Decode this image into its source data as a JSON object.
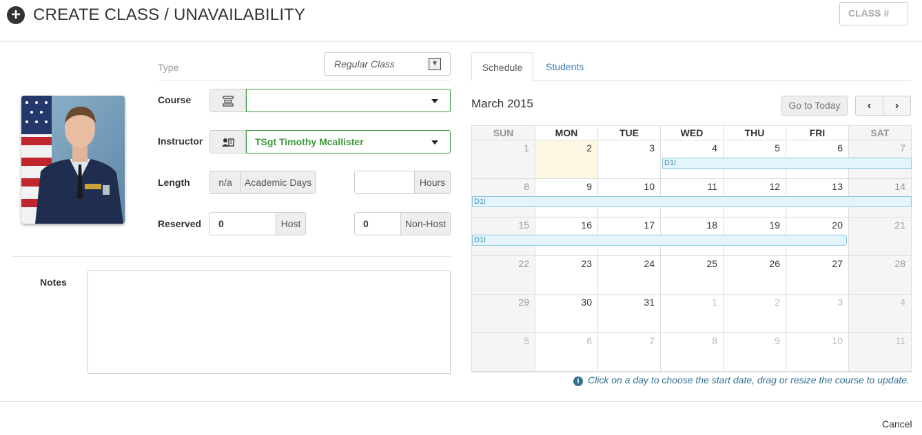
{
  "header": {
    "icon": "plus-circle-icon",
    "title": "CREATE CLASS / UNAVAILABILITY",
    "class_no_placeholder": "CLASS #"
  },
  "form": {
    "type_label": "Type",
    "type_value": "Regular Class",
    "course_label": "Course",
    "course_value": "",
    "instructor_label": "Instructor",
    "instructor_value": "TSgt Timothy Mcallister",
    "length_label": "Length",
    "length_value": "n/a",
    "academic_days_label": "Academic Days",
    "hours_value": "",
    "hours_label": "Hours",
    "reserved_label": "Reserved",
    "host_value": "0",
    "host_label": "Host",
    "nonhost_value": "0",
    "nonhost_label": "Non-Host",
    "notes_label": "Notes",
    "notes_value": ""
  },
  "tabs": {
    "schedule": "Schedule",
    "students": "Students"
  },
  "calendar": {
    "month_title": "March 2015",
    "today_button": "Go to Today",
    "prev": "‹",
    "next": "›",
    "days": [
      "SUN",
      "MON",
      "TUE",
      "WED",
      "THU",
      "FRI",
      "SAT"
    ],
    "weeks": [
      [
        "1",
        "2",
        "3",
        "4",
        "5",
        "6",
        "7"
      ],
      [
        "8",
        "9",
        "10",
        "11",
        "12",
        "13",
        "14"
      ],
      [
        "15",
        "16",
        "17",
        "18",
        "19",
        "20",
        "21"
      ],
      [
        "22",
        "23",
        "24",
        "25",
        "26",
        "27",
        "28"
      ],
      [
        "29",
        "30",
        "31",
        "1",
        "2",
        "3",
        "4"
      ],
      [
        "5",
        "6",
        "7",
        "8",
        "9",
        "10",
        "11"
      ]
    ],
    "event_label": "D1I",
    "today_day": "2",
    "hint": "Click on a day to choose the start date, drag or resize the course to update."
  },
  "footer": {
    "cancel": "Cancel"
  },
  "colors": {
    "accent": "#337ab7",
    "valid_green": "#3c9a3c",
    "event_bg": "#e3f4fb",
    "today_bg": "#fcf8e3"
  }
}
